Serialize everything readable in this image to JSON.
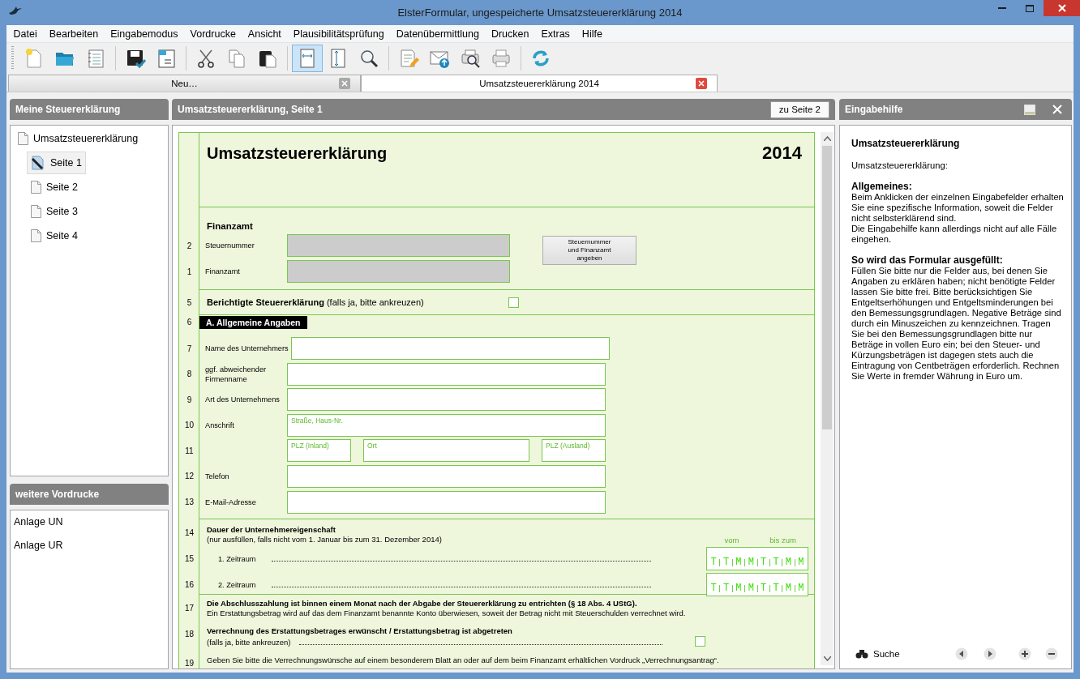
{
  "window": {
    "title": "ElsterFormular, ungespeicherte Umsatzsteuererklärung 2014"
  },
  "menu": [
    "Datei",
    "Bearbeiten",
    "Eingabemodus",
    "Vordrucke",
    "Ansicht",
    "Plausibilitätsprüfung",
    "Datenübermittlung",
    "Drucken",
    "Extras",
    "Hilfe"
  ],
  "toolbar": [
    {
      "items": [
        {
          "kind": "new",
          "selected": false
        },
        {
          "kind": "open",
          "selected": false
        },
        {
          "kind": "list",
          "selected": false
        }
      ]
    },
    {
      "items": [
        {
          "kind": "save",
          "selected": false
        },
        {
          "kind": "calendar",
          "selected": false
        }
      ]
    },
    {
      "items": [
        {
          "kind": "cut",
          "selected": false
        },
        {
          "kind": "copy",
          "selected": false
        },
        {
          "kind": "paste",
          "selected": false
        }
      ]
    },
    {
      "items": [
        {
          "kind": "fitwidth",
          "selected": true
        },
        {
          "kind": "fitheight",
          "selected": false
        },
        {
          "kind": "zoom",
          "selected": false
        }
      ]
    },
    {
      "items": [
        {
          "kind": "check",
          "selected": false
        },
        {
          "kind": "send",
          "selected": false
        },
        {
          "kind": "preview",
          "selected": false
        },
        {
          "kind": "print",
          "selected": false
        }
      ]
    },
    {
      "items": [
        {
          "kind": "refresh",
          "selected": false
        }
      ]
    }
  ],
  "tabs": [
    {
      "label": "Neu…",
      "selected": false
    },
    {
      "label": "Umsatzsteuererklärung 2014",
      "selected": true
    }
  ],
  "left": {
    "title": "Meine Steuererklärung",
    "tree": {
      "label": "Umsatzsteuererklärung",
      "children": [
        {
          "label": "Seite 1",
          "selected": true
        },
        {
          "label": "Seite 2",
          "selected": false
        },
        {
          "label": "Seite 3",
          "selected": false
        },
        {
          "label": "Seite 4",
          "selected": false
        }
      ]
    }
  },
  "more": {
    "title": "weitere Vordrucke",
    "items": [
      "Anlage UN",
      "Anlage UR"
    ]
  },
  "center": {
    "title": "Umsatzsteuererklärung, Seite 1",
    "button": "zu Seite 2"
  },
  "form": {
    "title": "Umsatzsteuererklärung",
    "year": "2014",
    "office": {
      "heading": "Finanzamt",
      "rows": [
        {
          "line": "2",
          "label": "Steuernummer"
        },
        {
          "line": "1",
          "label": "Finanzamt"
        }
      ],
      "button": "Steuernummer\nund Finanzamt\nangeben"
    },
    "corrected": {
      "line": "5",
      "text": "**Berichtigte Steuererklärung** (falls ja, bitte ankreuzen)",
      "checked": false
    },
    "general": {
      "line": "6",
      "heading": "A.  Allgemeine Angaben",
      "rows": [
        {
          "line": "7",
          "label": "Name des Unternehmers",
          "kind": "field"
        },
        {
          "line": "8",
          "label": "ggf. abweichender\nFirmenname",
          "kind": "field"
        },
        {
          "line": "9",
          "label": "Art des Unternehmens",
          "kind": "field"
        },
        {
          "line": "10",
          "label": "Anschrift",
          "kind": "field",
          "placeholder": "Straße, Haus-Nr."
        },
        {
          "line": "11",
          "kind": "split",
          "fields": [
            {
              "placeholder": "PLZ (Inland)",
              "kind": "digits"
            },
            {
              "placeholder": "Ort",
              "kind": "wide"
            },
            {
              "placeholder": "PLZ (Ausland)",
              "kind": "short"
            }
          ]
        },
        {
          "line": "12",
          "label": "Telefon",
          "kind": "field"
        },
        {
          "line": "13",
          "label": "E-Mail-Adresse",
          "kind": "field"
        }
      ]
    },
    "period": {
      "line": "14",
      "title": "Dauer der Unternehmereigenschaft",
      "note": "(nur ausfüllen, falls nicht vom 1. Januar bis zum 31. Dezember 2014)",
      "from": "vom",
      "to": "bis zum",
      "rows": [
        {
          "line": "15",
          "label": "1. Zeitraum",
          "mask": [
            "T",
            "T",
            "M",
            "M",
            "T",
            "T",
            "M",
            "M"
          ]
        },
        {
          "line": "16",
          "label": "2. Zeitraum",
          "mask": [
            "T",
            "T",
            "M",
            "M",
            "T",
            "T",
            "M",
            "M"
          ]
        }
      ]
    },
    "payment": [
      {
        "line": "17",
        "kind": "text",
        "bold": "Die Abschlusszahlung ist binnen einem Monat nach der Abgabe der Steuererklärung zu entrichten (§ 18 Abs. 4 UStG).",
        "text": "Ein Erstattungsbetrag wird auf das dem Finanzamt benannte Konto überwiesen, soweit der Betrag nicht mit Steuerschulden verrechnet wird."
      },
      {
        "line": "18",
        "kind": "check",
        "bold": "Verrechnung des Erstattungsbetrages erwünscht / Erstattungsbetrag ist abgetreten",
        "text": "(falls ja, bitte ankreuzen)",
        "checked": false
      },
      {
        "line": "19",
        "kind": "text",
        "text": "Geben Sie bitte die Verrechnungswünsche auf einem besonderem Blatt an oder auf dem beim Finanzamt erhältlichen Vordruck „Verrechnungsantrag“."
      }
    ]
  },
  "help": {
    "title": "Eingabehilfe",
    "heading": "Umsatzsteuererklärung",
    "intro": "Umsatzsteuererklärung:",
    "blocks": [
      {
        "heading": "Allgemeines:",
        "paragraphs": [
          "Beim Anklicken der einzelnen Eingabefelder erhalten Sie eine spezifische Information, soweit die Felder nicht selbsterklärend sind.",
          "Die Eingabehilfe kann allerdings nicht auf alle Fälle eingehen."
        ]
      },
      {
        "heading": "So wird das Formular ausgefüllt:",
        "paragraphs": [
          "Füllen Sie bitte nur die Felder aus, bei denen Sie Angaben zu erklären haben; nicht benötigte Felder lassen Sie bitte frei. Bitte berücksichtigen Sie Entgeltserhöhungen und Entgeltsminderungen bei den Bemessungsgrundlagen. Negative Beträge sind durch ein Minuszeichen zu kennzeichnen. Tragen Sie bei den Bemessungsgrundlagen bitte nur Beträge in vollen Euro ein; bei den Steuer- und Kürzungsbeträgen ist dagegen stets auch die Eintragung von Centbeträgen erforderlich. Rechnen Sie Werte in fremder Währung in Euro um."
        ]
      }
    ],
    "search": "Suche"
  }
}
